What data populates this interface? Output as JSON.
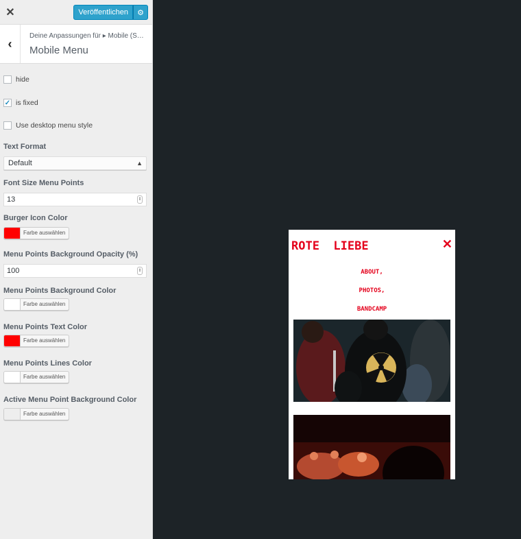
{
  "header": {
    "close_icon": "close-icon",
    "publish_label": "Veröffentlichen",
    "gear_icon": "gear-icon"
  },
  "section": {
    "breadcrumb": "Deine Anpassungen für ▸ Mobile (S…",
    "title": "Mobile Menu"
  },
  "controls": {
    "hide": {
      "label": "hide",
      "checked": false
    },
    "is_fixed": {
      "label": "is fixed",
      "checked": true
    },
    "desktop_style": {
      "label": "Use desktop menu style",
      "checked": false
    },
    "text_format": {
      "label": "Text Format",
      "value": "Default"
    },
    "font_size": {
      "label": "Font Size Menu Points",
      "value": "13"
    },
    "burger_color": {
      "label": "Burger Icon Color",
      "button": "Farbe auswählen",
      "color": "#ff0000"
    },
    "bg_opacity": {
      "label": "Menu Points Background Opacity (%)",
      "value": "100"
    },
    "bg_color": {
      "label": "Menu Points Background Color",
      "button": "Farbe auswählen",
      "color": "#ffffff"
    },
    "text_color": {
      "label": "Menu Points Text Color",
      "button": "Farbe auswählen",
      "color": "#ff0000"
    },
    "lines_color": {
      "label": "Menu Points Lines Color",
      "button": "Farbe auswählen",
      "color": "#ffffff"
    },
    "active_bg_color": {
      "label": "Active Menu Point Background Color",
      "button": "Farbe auswählen",
      "color": "#eeeeee"
    }
  },
  "preview": {
    "logo": "ROTE  LIEBE",
    "close_icon": "close-icon",
    "menu_items": [
      "ABOUT,",
      "PHOTOS,",
      "BANDCAMP"
    ],
    "accent": "#e4001b"
  }
}
